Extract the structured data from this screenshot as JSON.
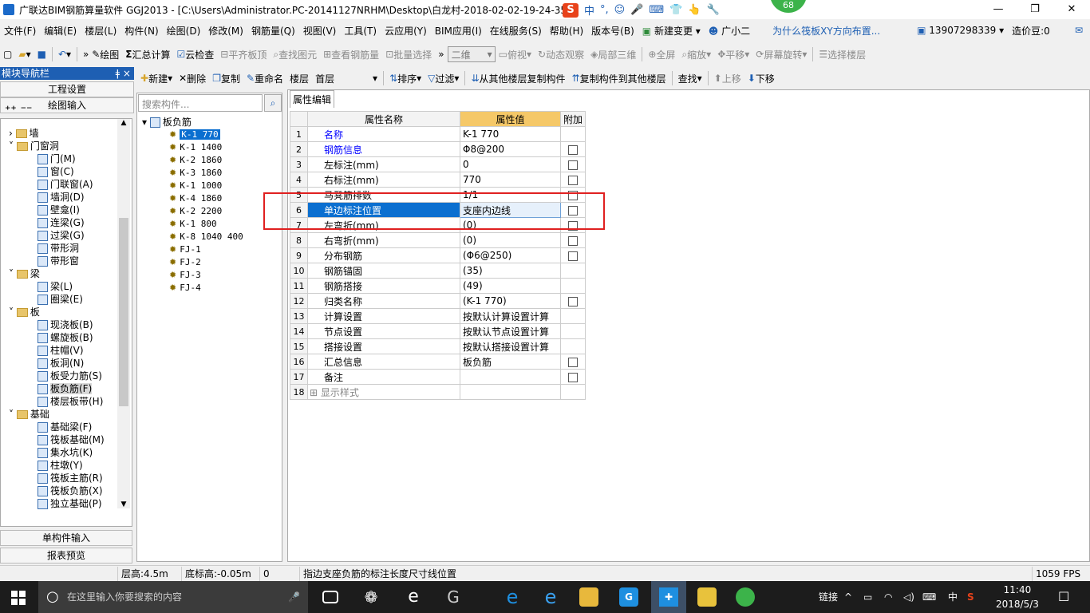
{
  "window": {
    "title": "广联达BIM钢筋算量软件 GGJ2013 - [C:\\Users\\Administrator.PC-20141127NRHM\\Desktop\\白龙村-2018-02-02-19-24-35",
    "badge": "68",
    "ime": {
      "logo": "S",
      "items": [
        "中",
        "°,",
        "☺",
        "🎤",
        "⌨",
        "👕",
        "👆",
        "🔧"
      ]
    }
  },
  "menu": {
    "items": [
      "文件(F)",
      "编辑(E)",
      "楼层(L)",
      "构件(N)",
      "绘图(D)",
      "修改(M)",
      "钢筋量(Q)",
      "视图(V)",
      "工具(T)",
      "云应用(Y)",
      "BIM应用(I)",
      "在线服务(S)",
      "帮助(H)",
      "版本号(B)",
      "新建变更",
      "广小二"
    ],
    "link": "为什么筏板XY方向布置...",
    "phone": "13907298339",
    "beans": "造价豆:0"
  },
  "toolbar1": {
    "draw": "绘图",
    "sum": "汇总计算",
    "cloud_check": "云检查",
    "flat_slab": "平齐板顶",
    "find_elem": "查找图元",
    "view_rebar": "查看钢筋量",
    "batch_select": "批量选择",
    "view_mode": "二维",
    "top_view": "俯视",
    "dyn_observe": "动态观察",
    "local_3d": "局部三维",
    "full_screen": "全屏",
    "zoom": "缩放",
    "pan": "平移",
    "rotate": "屏幕旋转",
    "select_floor": "选择楼层"
  },
  "toolbar2": {
    "new": "新建",
    "delete": "删除",
    "copy": "复制",
    "rename": "重命名",
    "floor_label": "楼层",
    "floor_value": "首层",
    "sort": "排序",
    "filter": "过滤",
    "copy_from": "从其他楼层复制构件",
    "copy_to": "复制构件到其他楼层",
    "find": "查找",
    "move_up": "上移",
    "move_down": "下移"
  },
  "nav": {
    "title": "模块导航栏",
    "pin": "ǂ ×",
    "project_settings": "工程设置",
    "drawing_input": "绘图输入",
    "tree": [
      {
        "label": "墙",
        "level": 0,
        "type": "folder",
        "exp": "›"
      },
      {
        "label": "门窗洞",
        "level": 0,
        "type": "folder",
        "exp": "˅"
      },
      {
        "label": "门(M)",
        "level": 1,
        "type": "item"
      },
      {
        "label": "窗(C)",
        "level": 1,
        "type": "item"
      },
      {
        "label": "门联窗(A)",
        "level": 1,
        "type": "item"
      },
      {
        "label": "墙洞(D)",
        "level": 1,
        "type": "item"
      },
      {
        "label": "壁龛(I)",
        "level": 1,
        "type": "item"
      },
      {
        "label": "连梁(G)",
        "level": 1,
        "type": "item"
      },
      {
        "label": "过梁(G)",
        "level": 1,
        "type": "item"
      },
      {
        "label": "带形洞",
        "level": 1,
        "type": "item"
      },
      {
        "label": "带形窗",
        "level": 1,
        "type": "item"
      },
      {
        "label": "梁",
        "level": 0,
        "type": "folder",
        "exp": "˅"
      },
      {
        "label": "梁(L)",
        "level": 1,
        "type": "item"
      },
      {
        "label": "圈梁(E)",
        "level": 1,
        "type": "item"
      },
      {
        "label": "板",
        "level": 0,
        "type": "folder",
        "exp": "˅"
      },
      {
        "label": "现浇板(B)",
        "level": 1,
        "type": "item"
      },
      {
        "label": "螺旋板(B)",
        "level": 1,
        "type": "item"
      },
      {
        "label": "柱帽(V)",
        "level": 1,
        "type": "item"
      },
      {
        "label": "板洞(N)",
        "level": 1,
        "type": "item"
      },
      {
        "label": "板受力筋(S)",
        "level": 1,
        "type": "item"
      },
      {
        "label": "板负筋(F)",
        "level": 1,
        "type": "item",
        "selected": true
      },
      {
        "label": "楼层板带(H)",
        "level": 1,
        "type": "item"
      },
      {
        "label": "基础",
        "level": 0,
        "type": "folder",
        "exp": "˅"
      },
      {
        "label": "基础梁(F)",
        "level": 1,
        "type": "item"
      },
      {
        "label": "筏板基础(M)",
        "level": 1,
        "type": "item"
      },
      {
        "label": "集水坑(K)",
        "level": 1,
        "type": "item"
      },
      {
        "label": "柱墩(Y)",
        "level": 1,
        "type": "item"
      },
      {
        "label": "筏板主筋(R)",
        "level": 1,
        "type": "item"
      },
      {
        "label": "筏板负筋(X)",
        "level": 1,
        "type": "item"
      },
      {
        "label": "独立基础(P)",
        "level": 1,
        "type": "item"
      }
    ],
    "single_input": "单构件输入",
    "report_preview": "报表预览"
  },
  "components": {
    "search_placeholder": "搜索构件...",
    "root": "板负筋",
    "items": [
      "K-1 770",
      "K-1 1400",
      "K-2 1860",
      "K-3 1860",
      "K-1 1000",
      "K-4 1860",
      "K-2 2200",
      "K-1 800",
      "K-8 1040 400",
      "FJ-1",
      "FJ-2",
      "FJ-3",
      "FJ-4"
    ],
    "selected_index": 0
  },
  "props": {
    "tab": "属性编辑",
    "headers": {
      "name": "属性名称",
      "value": "属性值",
      "extra": "附加"
    },
    "rows": [
      {
        "n": "1",
        "name": "名称",
        "value": "K-1 770",
        "blue": true,
        "chk": false
      },
      {
        "n": "2",
        "name": "钢筋信息",
        "value": "Φ8@200",
        "blue": true,
        "chk": true
      },
      {
        "n": "3",
        "name": "左标注(mm)",
        "value": "0",
        "blue": false,
        "chk": true
      },
      {
        "n": "4",
        "name": "右标注(mm)",
        "value": "770",
        "blue": false,
        "chk": true
      },
      {
        "n": "5",
        "name": "马凳筋排数",
        "value": "1/1",
        "blue": false,
        "chk": true
      },
      {
        "n": "6",
        "name": "单边标注位置",
        "value": "支座内边线",
        "blue": false,
        "chk": true,
        "selected": true
      },
      {
        "n": "7",
        "name": "左弯折(mm)",
        "value": "(0)",
        "blue": false,
        "chk": true
      },
      {
        "n": "8",
        "name": "右弯折(mm)",
        "value": "(0)",
        "blue": false,
        "chk": true
      },
      {
        "n": "9",
        "name": "分布钢筋",
        "value": "(Φ6@250)",
        "blue": false,
        "chk": true
      },
      {
        "n": "10",
        "name": "钢筋锚固",
        "value": "(35)",
        "blue": false,
        "chk": false
      },
      {
        "n": "11",
        "name": "钢筋搭接",
        "value": "(49)",
        "blue": false,
        "chk": false
      },
      {
        "n": "12",
        "name": "归类名称",
        "value": "(K-1 770)",
        "blue": false,
        "chk": true
      },
      {
        "n": "13",
        "name": "计算设置",
        "value": "按默认计算设置计算",
        "blue": false,
        "chk": false
      },
      {
        "n": "14",
        "name": "节点设置",
        "value": "按默认节点设置计算",
        "blue": false,
        "chk": false
      },
      {
        "n": "15",
        "name": "搭接设置",
        "value": "按默认搭接设置计算",
        "blue": false,
        "chk": false
      },
      {
        "n": "16",
        "name": "汇总信息",
        "value": "板负筋",
        "blue": false,
        "chk": true
      },
      {
        "n": "17",
        "name": "备注",
        "value": "",
        "blue": false,
        "chk": true
      },
      {
        "n": "18",
        "name": "显示样式",
        "value": "",
        "blue": false,
        "chk": false,
        "expand": true
      }
    ]
  },
  "status": {
    "floor_height": "层高:4.5m",
    "bottom_elev": "底标高:-0.05m",
    "zero": "0",
    "hint": "指边支座负筋的标注长度尺寸线位置",
    "fps": "1059 FPS"
  },
  "taskbar": {
    "search_placeholder": "在这里输入你要搜索的内容",
    "link": "链接",
    "lang": "中",
    "time": "11:40",
    "date": "2018/5/3"
  },
  "colors": {
    "accent": "#1e5fb3",
    "selection": "#0b6fd0",
    "highlight_box": "#e02020",
    "header_value": "#f5c868"
  }
}
